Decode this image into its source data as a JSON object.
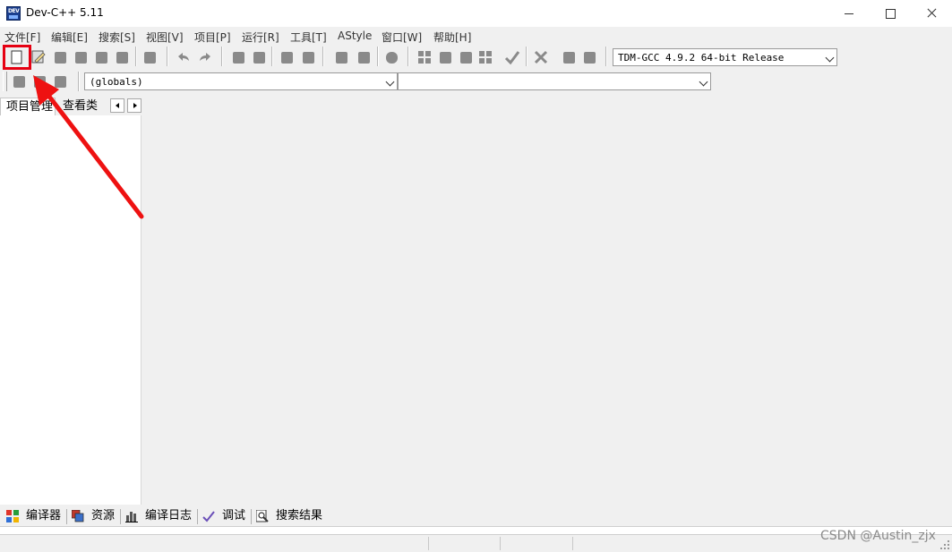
{
  "window": {
    "title": "Dev-C++ 5.11",
    "app_icon_text": "DEV"
  },
  "menu": [
    {
      "label": "文件[F]"
    },
    {
      "label": "编辑[E]"
    },
    {
      "label": "搜索[S]"
    },
    {
      "label": "视图[V]"
    },
    {
      "label": "项目[P]"
    },
    {
      "label": "运行[R]"
    },
    {
      "label": "工具[T]"
    },
    {
      "label": "AStyle"
    },
    {
      "label": "窗口[W]"
    },
    {
      "label": "帮助[H]"
    }
  ],
  "toolbar": {
    "compiler_select": "TDM-GCC 4.9.2 64-bit Release",
    "scope_select": "(globals)",
    "member_select": ""
  },
  "left_panel": {
    "tabs": [
      "项目管理",
      "查看类"
    ]
  },
  "bottom_tabs": [
    {
      "label": "编译器",
      "icon": "compiler-icon"
    },
    {
      "label": "资源",
      "icon": "resources-icon"
    },
    {
      "label": "编译日志",
      "icon": "chart-icon"
    },
    {
      "label": "调试",
      "icon": "check-icon"
    },
    {
      "label": "搜索结果",
      "icon": "search-icon"
    }
  ],
  "watermark": "CSDN @Austin_zjx",
  "colors": {
    "highlight": "#e60012",
    "app_icon": "#1b3f8f"
  }
}
